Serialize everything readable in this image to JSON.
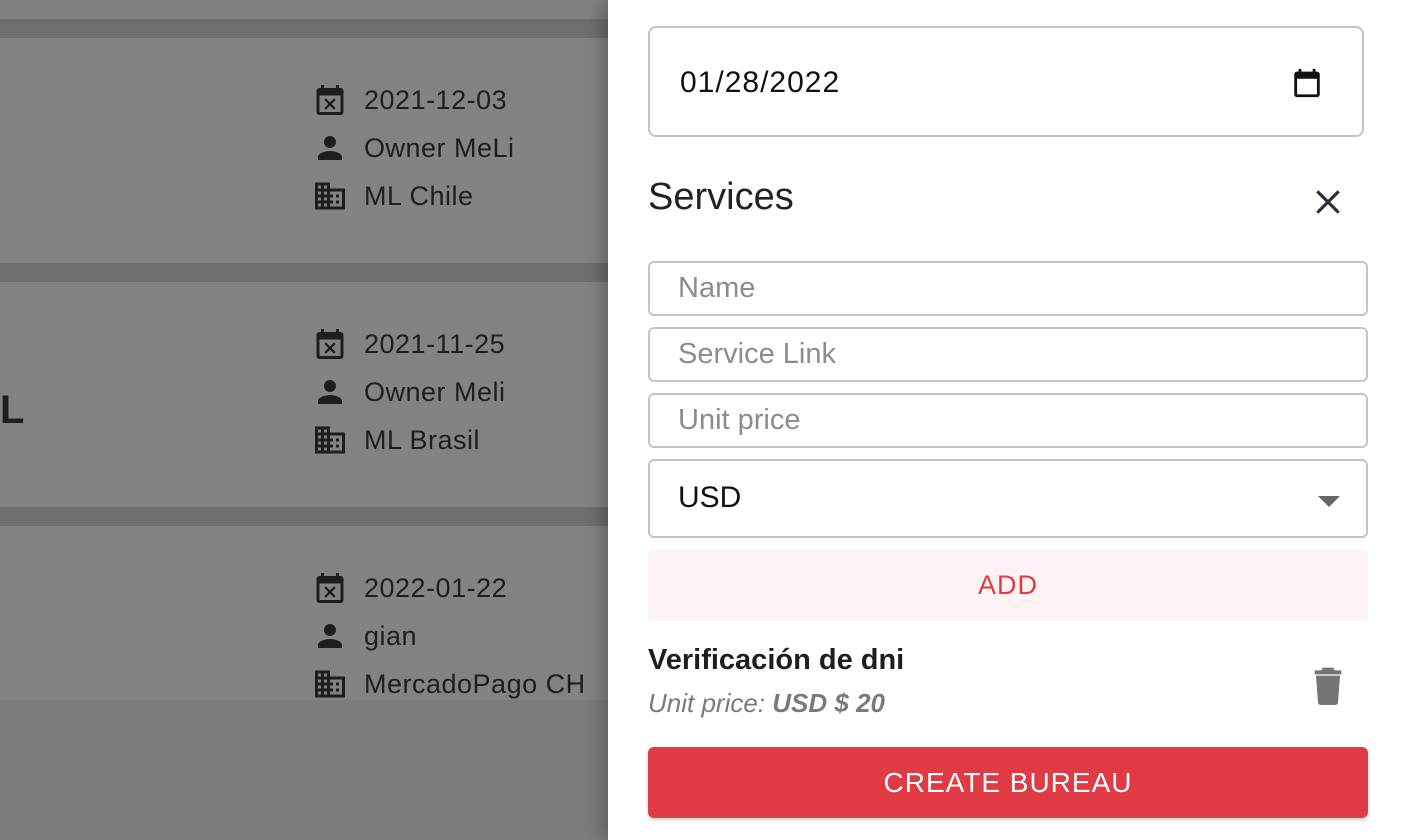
{
  "background_list": {
    "cards": [
      {
        "date": "2021-12-03",
        "owner": "Owner MeLi",
        "company": "ML Chile"
      },
      {
        "date": "2021-11-25",
        "owner": "Owner Meli",
        "company": "ML Brasil",
        "partial_title": "L"
      },
      {
        "date": "2022-01-22",
        "owner": "gian",
        "company": "MercadoPago CH"
      }
    ]
  },
  "drawer": {
    "date_value": "01/28/2022",
    "services_title": "Services",
    "name_placeholder": "Name",
    "link_placeholder": "Service Link",
    "price_placeholder": "Unit price",
    "currency_selected": "USD",
    "add_label": "ADD",
    "service_item": {
      "name": "Verificación de dni",
      "price_label": "Unit price:",
      "price_value": "USD $ 20"
    },
    "create_label": "CREATE BUREAU"
  },
  "colors": {
    "accent": "#e03b44",
    "accent_soft": "#fdf3f4",
    "overlay": "#808080"
  }
}
